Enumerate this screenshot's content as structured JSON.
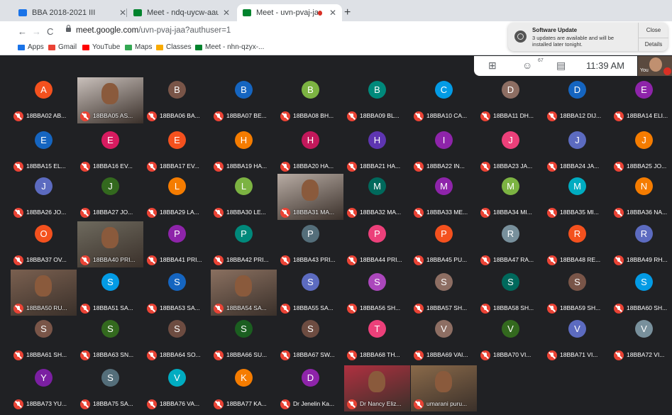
{
  "browser": {
    "tabs": [
      {
        "title": "BBA 2018-2021 III",
        "favicon_color": "#1a73e8"
      },
      {
        "title": "Meet - ndq-uycw-aau",
        "favicon_color": "#00832d"
      },
      {
        "title": "Meet - uvn-pvaj-jaa",
        "favicon_color": "#00832d"
      }
    ],
    "url_domain": "meet.google.com",
    "url_path": "/uvn-pvaj-jaa?authuser=1",
    "bookmarks": [
      {
        "label": "Apps",
        "icon": "grid-icon",
        "color": "#1a73e8"
      },
      {
        "label": "Gmail",
        "icon": "gmail-icon",
        "color": "#ea4335"
      },
      {
        "label": "YouTube",
        "icon": "youtube-icon",
        "color": "#ff0000"
      },
      {
        "label": "Maps",
        "icon": "maps-icon",
        "color": "#34a853"
      },
      {
        "label": "Classes",
        "icon": "classroom-icon",
        "color": "#f9ab00"
      },
      {
        "label": "Meet - nhn-qzyx-...",
        "icon": "meet-icon",
        "color": "#00832d"
      }
    ]
  },
  "notification": {
    "title": "Software Update",
    "body": "3 updates are available and will be installed later tonight.",
    "close": "Close",
    "details": "Details"
  },
  "meet": {
    "participant_count": "67",
    "time": "11:39 AM",
    "self_label": "You",
    "tiles": [
      {
        "letter": "A",
        "name": "18BBA02 AB...",
        "color": "#f4511e"
      },
      {
        "letter": "",
        "name": "18BBA05 AS...",
        "color": "#c9c0bb",
        "video": true
      },
      {
        "letter": "B",
        "name": "18BBA06 BA...",
        "color": "#795548"
      },
      {
        "letter": "B",
        "name": "18BBA07 BE...",
        "color": "#1565c0"
      },
      {
        "letter": "B",
        "name": "18BBA08 BH...",
        "color": "#7cb342"
      },
      {
        "letter": "B",
        "name": "18BBA09 BL...",
        "color": "#00897b"
      },
      {
        "letter": "C",
        "name": "18BBA10 CA...",
        "color": "#039be5"
      },
      {
        "letter": "D",
        "name": "18BBA11 DH...",
        "color": "#8d6e63"
      },
      {
        "letter": "D",
        "name": "18BBA12 DIJ...",
        "color": "#1565c0"
      },
      {
        "letter": "E",
        "name": "18BBA14 ELI...",
        "color": "#8e24aa"
      },
      {
        "letter": "E",
        "name": "18BBA15 EL...",
        "color": "#1565c0"
      },
      {
        "letter": "E",
        "name": "18BBA16 EV...",
        "color": "#d81b60"
      },
      {
        "letter": "E",
        "name": "18BBA17 EV...",
        "color": "#f4511e"
      },
      {
        "letter": "H",
        "name": "18BBA19 HA...",
        "color": "#f57c00"
      },
      {
        "letter": "H",
        "name": "18BBA20 HA...",
        "color": "#c2185b"
      },
      {
        "letter": "H",
        "name": "18BBA21 HA...",
        "color": "#5e35b1"
      },
      {
        "letter": "I",
        "name": "18BBA22 IN...",
        "color": "#8e24aa"
      },
      {
        "letter": "J",
        "name": "18BBA23 JA...",
        "color": "#ec407a"
      },
      {
        "letter": "J",
        "name": "18BBA24 JA...",
        "color": "#5c6bc0"
      },
      {
        "letter": "J",
        "name": "18BBA25 JO...",
        "color": "#f57c00"
      },
      {
        "letter": "J",
        "name": "18BBA26 JO...",
        "color": "#5c6bc0"
      },
      {
        "letter": "J",
        "name": "18BBA27 JO...",
        "color": "#33691e"
      },
      {
        "letter": "L",
        "name": "18BBA29 LA...",
        "color": "#f57c00"
      },
      {
        "letter": "L",
        "name": "18BBA30 LE...",
        "color": "#7cb342"
      },
      {
        "letter": "",
        "name": "18BBA31 MA...",
        "color": "#b8aca4",
        "video": true
      },
      {
        "letter": "M",
        "name": "18BBA32 MA...",
        "color": "#00695c"
      },
      {
        "letter": "M",
        "name": "18BBA33 ME...",
        "color": "#8e24aa"
      },
      {
        "letter": "M",
        "name": "18BBA34 MI...",
        "color": "#7cb342"
      },
      {
        "letter": "M",
        "name": "18BBA35 MI...",
        "color": "#00acc1"
      },
      {
        "letter": "N",
        "name": "18BBA36 NA...",
        "color": "#f57c00"
      },
      {
        "letter": "O",
        "name": "18BBA37 OV...",
        "color": "#f4511e"
      },
      {
        "letter": "",
        "name": "18BBA40 PRI...",
        "color": "#6e6a5e",
        "video": true
      },
      {
        "letter": "P",
        "name": "18BBA41 PRI...",
        "color": "#8e24aa"
      },
      {
        "letter": "P",
        "name": "18BBA42 PRI...",
        "color": "#00897b"
      },
      {
        "letter": "P",
        "name": "18BBA43 PRI...",
        "color": "#546e7a"
      },
      {
        "letter": "P",
        "name": "18BBA44 PRI...",
        "color": "#ec407a"
      },
      {
        "letter": "P",
        "name": "18BBA45 PU...",
        "color": "#f4511e"
      },
      {
        "letter": "R",
        "name": "18BBA47 RA...",
        "color": "#78909c"
      },
      {
        "letter": "R",
        "name": "18BBA48 RE...",
        "color": "#f4511e"
      },
      {
        "letter": "R",
        "name": "18BBA49 RH...",
        "color": "#5c6bc0"
      },
      {
        "letter": "",
        "name": "18BBA50 RU...",
        "color": "#7a6050",
        "video": true
      },
      {
        "letter": "S",
        "name": "18BBA51 SA...",
        "color": "#039be5"
      },
      {
        "letter": "S",
        "name": "18BBA53 SA...",
        "color": "#1565c0"
      },
      {
        "letter": "",
        "name": "18BBA54 SA...",
        "color": "#8a7060",
        "video": true
      },
      {
        "letter": "S",
        "name": "18BBA55 SA...",
        "color": "#5c6bc0"
      },
      {
        "letter": "S",
        "name": "18BBA56 SH...",
        "color": "#ab47bc"
      },
      {
        "letter": "S",
        "name": "18BBA57 SH...",
        "color": "#8d6e63"
      },
      {
        "letter": "S",
        "name": "18BBA58 SH...",
        "color": "#00695c"
      },
      {
        "letter": "S",
        "name": "18BBA59 SH...",
        "color": "#795548"
      },
      {
        "letter": "S",
        "name": "18BBA60 SH...",
        "color": "#039be5"
      },
      {
        "letter": "S",
        "name": "18BBA61 SH...",
        "color": "#795548"
      },
      {
        "letter": "S",
        "name": "18BBA63 SN...",
        "color": "#33691e"
      },
      {
        "letter": "S",
        "name": "18BBA64 SO...",
        "color": "#6d4c41"
      },
      {
        "letter": "S",
        "name": "18BBA66 SU...",
        "color": "#1b5e20"
      },
      {
        "letter": "S",
        "name": "18BBA67 SW...",
        "color": "#6d4c41"
      },
      {
        "letter": "T",
        "name": "18BBA68 TH...",
        "color": "#ec407a"
      },
      {
        "letter": "V",
        "name": "18BBA69 VAI...",
        "color": "#8d6e63"
      },
      {
        "letter": "V",
        "name": "18BBA70 VI...",
        "color": "#33691e"
      },
      {
        "letter": "V",
        "name": "18BBA71 VI...",
        "color": "#5c6bc0"
      },
      {
        "letter": "V",
        "name": "18BBA72 VI...",
        "color": "#78909c"
      },
      {
        "letter": "Y",
        "name": "18BBA73 YU...",
        "color": "#7b1fa2"
      },
      {
        "letter": "S",
        "name": "18BBA75 SA...",
        "color": "#546e7a"
      },
      {
        "letter": "V",
        "name": "18BBA76 VA...",
        "color": "#00acc1"
      },
      {
        "letter": "K",
        "name": "18BBA77 KA...",
        "color": "#f57c00"
      },
      {
        "letter": "D",
        "name": "Dr Jenelin Ka...",
        "color": "#8e24aa"
      },
      {
        "letter": "",
        "name": "Dr Nancy Eliz...",
        "color": "#b03040",
        "video": true
      },
      {
        "letter": "",
        "name": "umarani puru...",
        "color": "#8a6a4a",
        "video": true
      }
    ]
  }
}
